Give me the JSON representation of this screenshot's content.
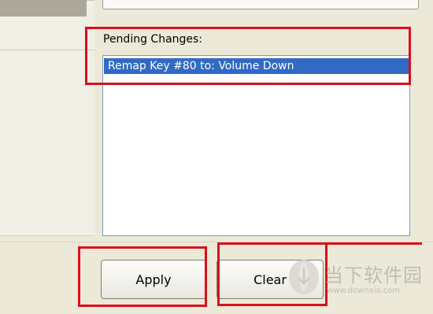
{
  "pending_changes": {
    "label": "Pending Changes:",
    "items": [
      {
        "text": "Remap Key #80 to: Volume Down",
        "selected": true
      }
    ]
  },
  "buttons": {
    "apply": "Apply",
    "clear": "Clear"
  },
  "watermark": {
    "text": "当下软件园",
    "url": "www.downxia.com"
  },
  "colors": {
    "selection": "#316ac5",
    "highlight_box": "#d9101c",
    "window_bg": "#ece9d8"
  }
}
